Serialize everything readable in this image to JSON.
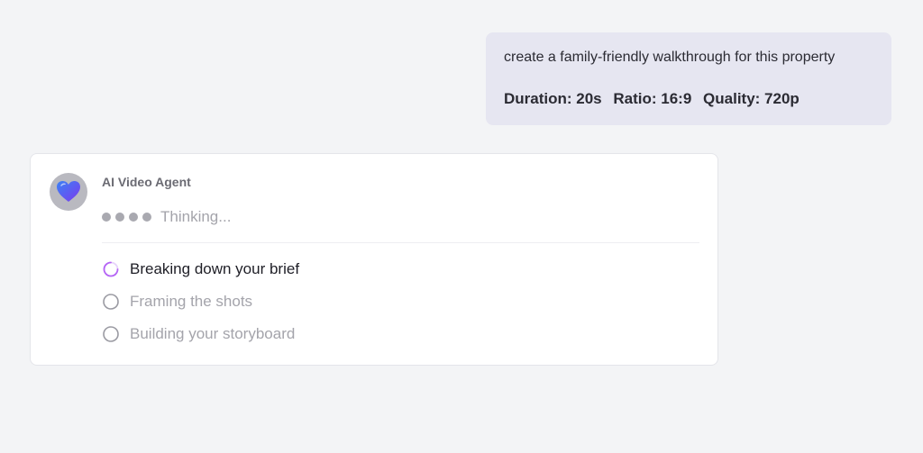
{
  "user_message": {
    "prompt": "create a family-friendly walkthrough for this property",
    "duration": "Duration: 20s",
    "ratio": "Ratio: 16:9",
    "quality": "Quality: 720p"
  },
  "agent": {
    "name": "AI Video Agent",
    "avatar_icon": "heart-icon",
    "status_text": "Thinking...",
    "steps": [
      {
        "label": "Breaking down your brief",
        "state": "in-progress",
        "icon": "spinner-icon"
      },
      {
        "label": "Framing the shots",
        "state": "pending",
        "icon": "empty-circle-icon"
      },
      {
        "label": "Building your storyboard",
        "state": "pending",
        "icon": "empty-circle-icon"
      }
    ]
  },
  "colors": {
    "background": "#f3f4f6",
    "user_bubble": "#e6e6f1",
    "spinner_accent": "#b565f5",
    "heart_fill": "#4f46e5"
  }
}
